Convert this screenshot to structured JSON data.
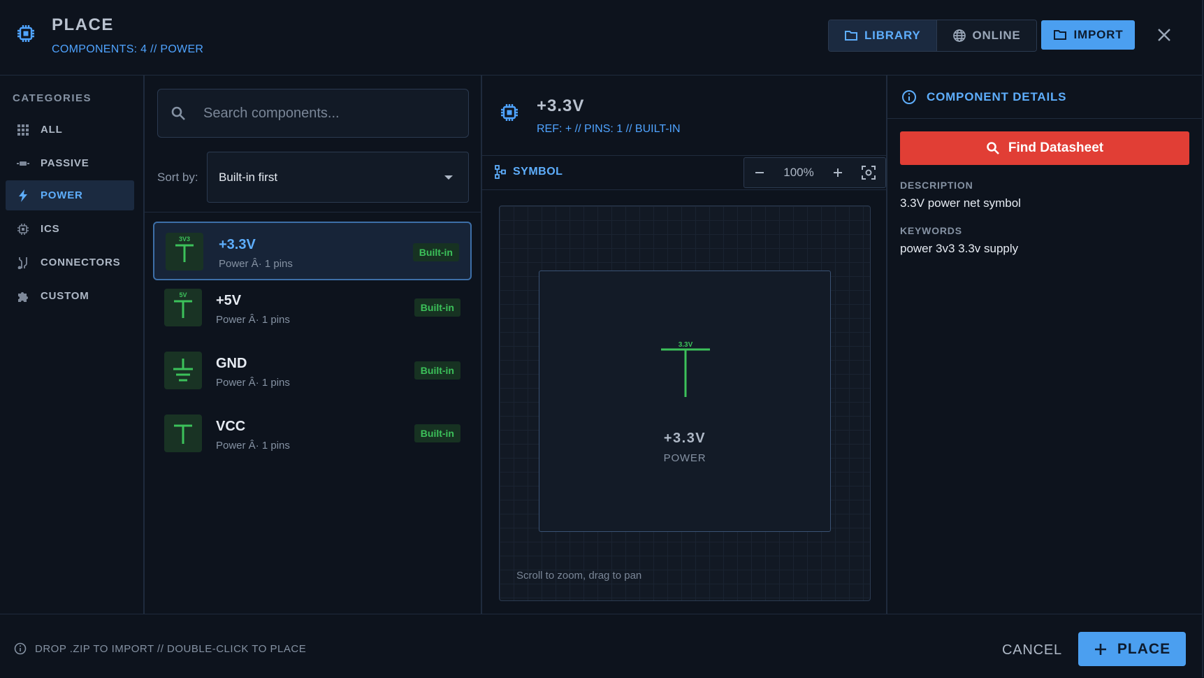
{
  "header": {
    "title": "PLACE",
    "subtitle": "COMPONENTS: 4 // POWER",
    "tabs": [
      {
        "label": "LIBRARY",
        "icon": "folder-icon",
        "active": true
      },
      {
        "label": "ONLINE",
        "icon": "globe-icon",
        "active": false
      }
    ],
    "import_label": "IMPORT",
    "close_icon": "close-icon"
  },
  "sidebar": {
    "title": "CATEGORIES",
    "items": [
      {
        "label": "ALL",
        "icon": "grid-icon",
        "active": false
      },
      {
        "label": "PASSIVE",
        "icon": "resistor-icon",
        "active": false
      },
      {
        "label": "POWER",
        "icon": "bolt-icon",
        "active": true
      },
      {
        "label": "ICS",
        "icon": "chip-icon",
        "active": false
      },
      {
        "label": "CONNECTORS",
        "icon": "connector-icon",
        "active": false
      },
      {
        "label": "CUSTOM",
        "icon": "puzzle-icon",
        "active": false
      }
    ]
  },
  "list": {
    "search_placeholder": "Search components...",
    "sort_label": "Sort by:",
    "sort_value": "Built-in first",
    "components": [
      {
        "name": "+3.3V",
        "meta": "Power Â· 1 pins",
        "badge": "Built-in",
        "thumb_label": "3V3",
        "symbol": "power-flag",
        "selected": true
      },
      {
        "name": "+5V",
        "meta": "Power Â· 1 pins",
        "badge": "Built-in",
        "thumb_label": "5V",
        "symbol": "power-flag",
        "selected": false
      },
      {
        "name": "GND",
        "meta": "Power Â· 1 pins",
        "badge": "Built-in",
        "thumb_label": "",
        "symbol": "ground",
        "selected": false
      },
      {
        "name": "VCC",
        "meta": "Power Â· 1 pins",
        "badge": "Built-in",
        "thumb_label": "",
        "symbol": "power-flag",
        "selected": false
      }
    ]
  },
  "preview": {
    "title": "+3.3V",
    "subtitle": "REF: + // PINS: 1 // BUILT-IN",
    "tab_label": "SYMBOL",
    "zoom": "100%",
    "symbol_pin_label": "3.3V",
    "symbol_name": "+3.3V",
    "symbol_type": "POWER",
    "hint": "Scroll to zoom, drag to pan"
  },
  "details": {
    "title": "COMPONENT DETAILS",
    "datasheet_label": "Find Datasheet",
    "description_label": "DESCRIPTION",
    "description": "3.3V power net symbol",
    "keywords_label": "KEYWORDS",
    "keywords": "power 3v3 3.3v supply"
  },
  "footer": {
    "hint": "DROP .ZIP TO IMPORT // DOUBLE-CLICK TO PLACE",
    "cancel_label": "CANCEL",
    "place_label": "PLACE"
  },
  "colors": {
    "accent": "#4b9ff0",
    "danger": "#e13e35",
    "success": "#3cc15a",
    "background": "#0d131d"
  }
}
